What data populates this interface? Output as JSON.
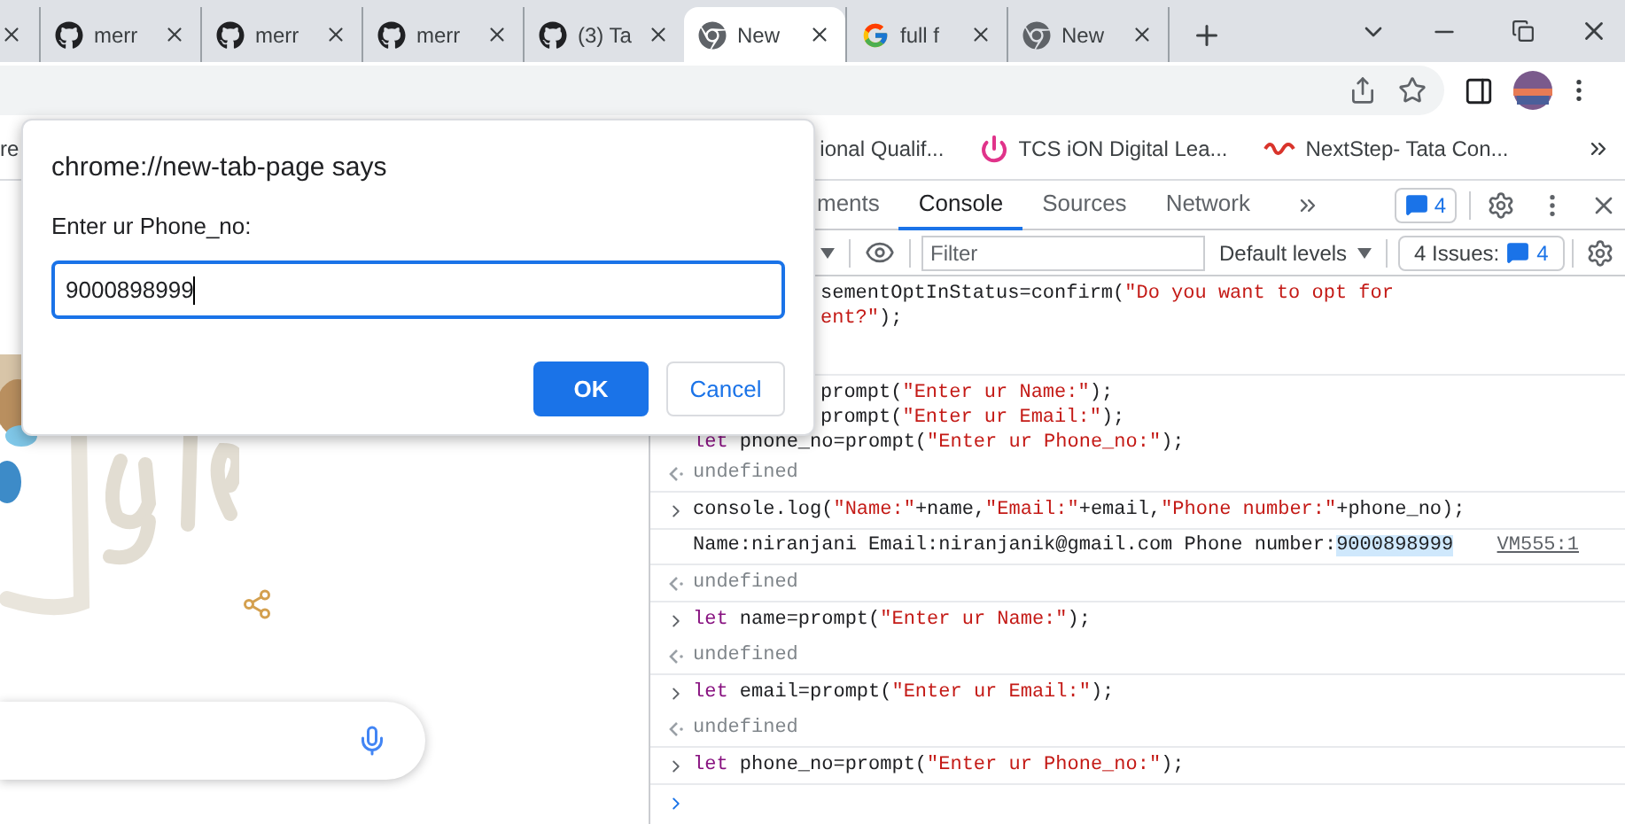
{
  "browser_tabs": [
    {
      "title": "merr",
      "kind": "github",
      "selected": false
    },
    {
      "title": "merr",
      "kind": "github",
      "selected": false
    },
    {
      "title": "merr",
      "kind": "github",
      "selected": false
    },
    {
      "title": "(3) Ta",
      "kind": "github",
      "selected": false
    },
    {
      "title": "New",
      "kind": "chrome",
      "selected": true
    },
    {
      "title": "full f",
      "kind": "google",
      "selected": false
    },
    {
      "title": "New",
      "kind": "chrome",
      "selected": false
    }
  ],
  "bookmarks": [
    {
      "title": "re"
    },
    {
      "title": "ional Qualif..."
    },
    {
      "title": "TCS iON Digital Lea...",
      "kind": "power"
    },
    {
      "title": "NextStep- Tata Con...",
      "kind": "swirl"
    }
  ],
  "dialog": {
    "title": "chrome://new-tab-page says",
    "label": "Enter ur Phone_no:",
    "value": "9000898999",
    "buttons": [
      {
        "label": "OK",
        "kind": "primary"
      },
      {
        "label": "Cancel",
        "kind": "secondary"
      }
    ]
  },
  "devtools": {
    "tabs": [
      {
        "label": "ments",
        "selected": false
      },
      {
        "label": "Console",
        "selected": true
      },
      {
        "label": "Sources",
        "selected": false
      },
      {
        "label": "Network",
        "selected": false
      }
    ],
    "messages_count": "4",
    "filter_placeholder": "Filter",
    "levels": "Default levels",
    "issues_label": "4 Issues:",
    "issues_count": "4",
    "console": [
      {
        "lines": [
          {
            "kind": "cut",
            "segments": [
              {
                "kind": "plain",
                "text": "sementOptInStatus=confirm("
              },
              {
                "kind": "string",
                "text": "\"Do you want to opt for"
              }
            ]
          },
          {
            "kind": "cut",
            "segments": [
              {
                "kind": "string",
                "text": "ent?\""
              },
              {
                "kind": "plain",
                "text": ");"
              }
            ]
          }
        ]
      },
      {
        "lines": [
          {
            "kind": "cut",
            "segments": [
              {
                "kind": "plain",
                "text": "prompt("
              },
              {
                "kind": "string",
                "text": "\"Enter ur Name:\""
              },
              {
                "kind": "plain",
                "text": ");"
              }
            ]
          },
          {
            "kind": "cut",
            "segments": [
              {
                "kind": "plain",
                "text": "prompt("
              },
              {
                "kind": "string",
                "text": "\"Enter ur Email:\""
              },
              {
                "kind": "plain",
                "text": ");"
              }
            ]
          },
          {
            "kind": "continuation",
            "segments": [
              {
                "kind": "keyword",
                "text": "let"
              },
              {
                "kind": "plain",
                "text": " phone_no=prompt("
              },
              {
                "kind": "string",
                "text": "\"Enter ur Phone_no:\""
              },
              {
                "kind": "plain",
                "text": ");"
              }
            ]
          },
          {
            "kind": "result",
            "segments": [
              {
                "kind": "muted",
                "text": "undefined"
              }
            ]
          }
        ]
      },
      {
        "lines": [
          {
            "kind": "input",
            "segments": [
              {
                "kind": "plain",
                "text": "console.log("
              },
              {
                "kind": "string",
                "text": "\"Name:\""
              },
              {
                "kind": "plain",
                "text": "+name,"
              },
              {
                "kind": "string",
                "text": "\"Email:\""
              },
              {
                "kind": "plain",
                "text": "+email,"
              },
              {
                "kind": "string",
                "text": "\"Phone number:\""
              },
              {
                "kind": "plain",
                "text": "+phone_no);"
              }
            ]
          }
        ]
      },
      {
        "lines": [
          {
            "kind": "log",
            "source": "VM555:1",
            "segments": [
              {
                "kind": "plain",
                "text": "Name:niranjani Email:niranjanik@gmail.com Phone number:"
              },
              {
                "kind": "selection",
                "text": "9000898999"
              }
            ]
          }
        ]
      },
      {
        "lines": [
          {
            "kind": "result",
            "segments": [
              {
                "kind": "muted",
                "text": "undefined"
              }
            ]
          }
        ]
      },
      {
        "lines": [
          {
            "kind": "input",
            "segments": [
              {
                "kind": "keyword",
                "text": "let"
              },
              {
                "kind": "plain",
                "text": " name=prompt("
              },
              {
                "kind": "string",
                "text": "\"Enter ur Name:\""
              },
              {
                "kind": "plain",
                "text": ");"
              }
            ]
          },
          {
            "kind": "result",
            "segments": [
              {
                "kind": "muted",
                "text": "undefined"
              }
            ]
          }
        ]
      },
      {
        "lines": [
          {
            "kind": "input",
            "segments": [
              {
                "kind": "keyword",
                "text": "let"
              },
              {
                "kind": "plain",
                "text": " email=prompt("
              },
              {
                "kind": "string",
                "text": "\"Enter ur Email:\""
              },
              {
                "kind": "plain",
                "text": ");"
              }
            ]
          },
          {
            "kind": "result",
            "segments": [
              {
                "kind": "muted",
                "text": "undefined"
              }
            ]
          }
        ]
      },
      {
        "lines": [
          {
            "kind": "input",
            "segments": [
              {
                "kind": "keyword",
                "text": "let"
              },
              {
                "kind": "plain",
                "text": " phone_no=prompt("
              },
              {
                "kind": "string",
                "text": "\"Enter ur Phone_no:\""
              },
              {
                "kind": "plain",
                "text": ");"
              }
            ]
          }
        ]
      }
    ]
  }
}
